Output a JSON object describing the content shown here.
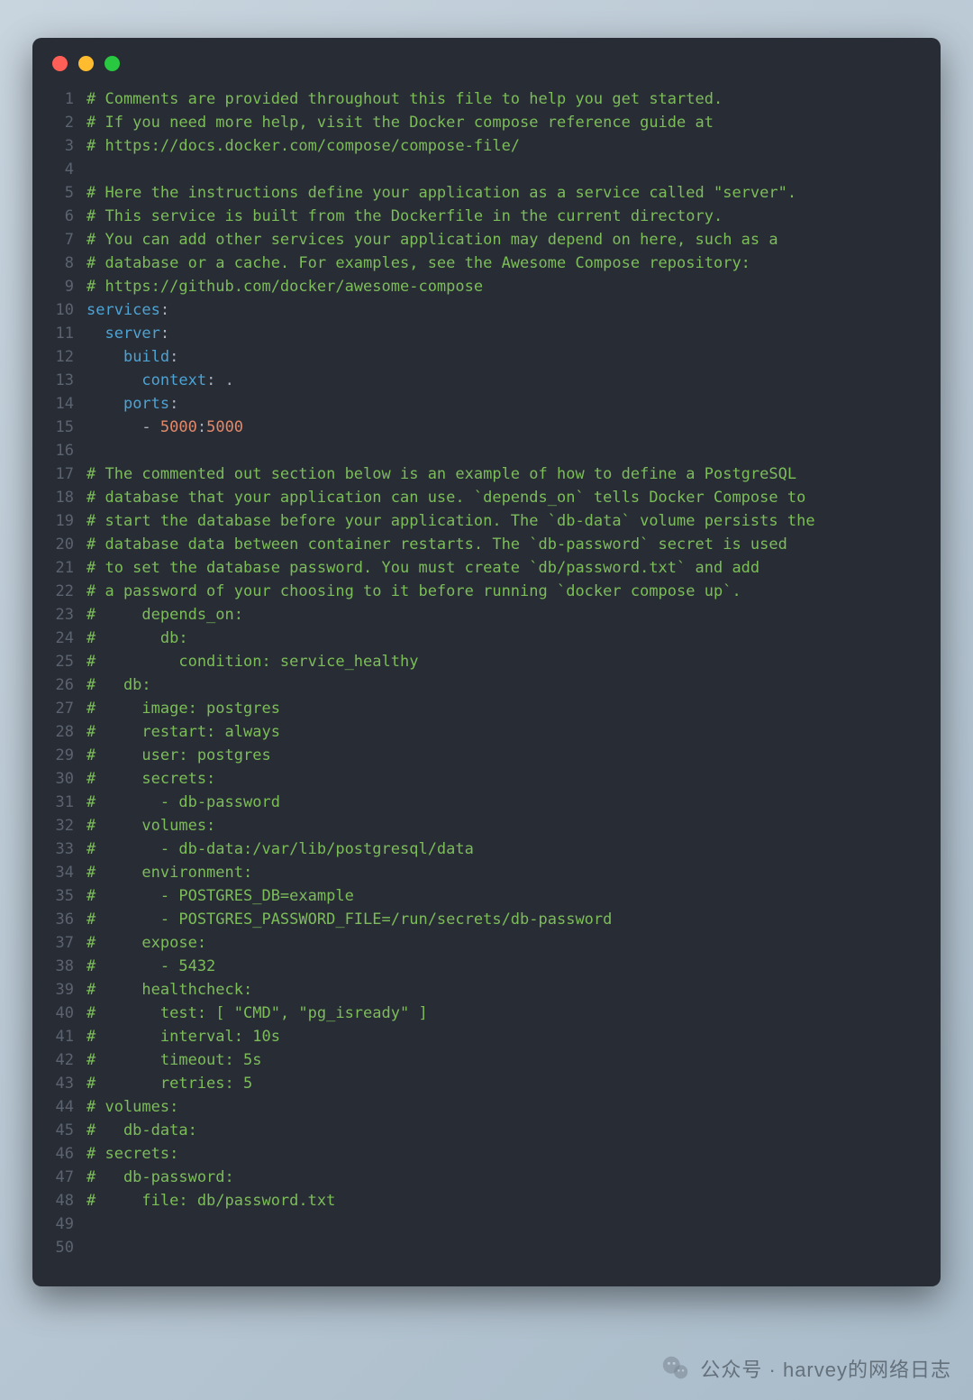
{
  "watermark": "公众号 · harvey的网络日志",
  "colors": {
    "bg": "#282c34",
    "comment": "#7cbd5a",
    "key": "#4da3d4",
    "num": "#e3896a",
    "default": "#abb2bf",
    "gutter": "#5c6370"
  },
  "lines": [
    {
      "n": 1,
      "tokens": [
        {
          "t": "# Comments are provided throughout this file to help you get started.",
          "cls": "c-comment"
        }
      ]
    },
    {
      "n": 2,
      "tokens": [
        {
          "t": "# If you need more help, visit the Docker compose reference guide at",
          "cls": "c-comment"
        }
      ]
    },
    {
      "n": 3,
      "tokens": [
        {
          "t": "# https://docs.docker.com/compose/compose-file/",
          "cls": "c-comment"
        }
      ]
    },
    {
      "n": 4,
      "tokens": [
        {
          "t": "",
          "cls": "c-plain"
        }
      ]
    },
    {
      "n": 5,
      "tokens": [
        {
          "t": "# Here the instructions define your application as a service called \"server\".",
          "cls": "c-comment"
        }
      ]
    },
    {
      "n": 6,
      "tokens": [
        {
          "t": "# This service is built from the Dockerfile in the current directory.",
          "cls": "c-comment"
        }
      ]
    },
    {
      "n": 7,
      "tokens": [
        {
          "t": "# You can add other services your application may depend on here, such as a",
          "cls": "c-comment"
        }
      ]
    },
    {
      "n": 8,
      "tokens": [
        {
          "t": "# database or a cache. For examples, see the Awesome Compose repository:",
          "cls": "c-comment"
        }
      ]
    },
    {
      "n": 9,
      "tokens": [
        {
          "t": "# https://github.com/docker/awesome-compose",
          "cls": "c-comment"
        }
      ]
    },
    {
      "n": 10,
      "tokens": [
        {
          "t": "services",
          "cls": "c-key"
        },
        {
          "t": ":",
          "cls": "c-punct"
        }
      ]
    },
    {
      "n": 11,
      "tokens": [
        {
          "t": "  ",
          "cls": "c-plain"
        },
        {
          "t": "server",
          "cls": "c-key"
        },
        {
          "t": ":",
          "cls": "c-punct"
        }
      ]
    },
    {
      "n": 12,
      "tokens": [
        {
          "t": "    ",
          "cls": "c-plain"
        },
        {
          "t": "build",
          "cls": "c-key"
        },
        {
          "t": ":",
          "cls": "c-punct"
        }
      ]
    },
    {
      "n": 13,
      "tokens": [
        {
          "t": "      ",
          "cls": "c-plain"
        },
        {
          "t": "context",
          "cls": "c-key"
        },
        {
          "t": ":",
          "cls": "c-punct"
        },
        {
          "t": " .",
          "cls": "c-plain"
        }
      ]
    },
    {
      "n": 14,
      "tokens": [
        {
          "t": "    ",
          "cls": "c-plain"
        },
        {
          "t": "ports",
          "cls": "c-key"
        },
        {
          "t": ":",
          "cls": "c-punct"
        }
      ]
    },
    {
      "n": 15,
      "tokens": [
        {
          "t": "      - ",
          "cls": "c-plain"
        },
        {
          "t": "5000",
          "cls": "c-num"
        },
        {
          "t": ":",
          "cls": "c-punct"
        },
        {
          "t": "5000",
          "cls": "c-num"
        }
      ]
    },
    {
      "n": 16,
      "tokens": [
        {
          "t": "",
          "cls": "c-plain"
        }
      ]
    },
    {
      "n": 17,
      "tokens": [
        {
          "t": "# The commented out section below is an example of how to define a PostgreSQL",
          "cls": "c-comment"
        }
      ]
    },
    {
      "n": 18,
      "tokens": [
        {
          "t": "# database that your application can use. `depends_on` tells Docker Compose to",
          "cls": "c-comment"
        }
      ]
    },
    {
      "n": 19,
      "tokens": [
        {
          "t": "# start the database before your application. The `db-data` volume persists the",
          "cls": "c-comment"
        }
      ]
    },
    {
      "n": 20,
      "tokens": [
        {
          "t": "# database data between container restarts. The `db-password` secret is used",
          "cls": "c-comment"
        }
      ]
    },
    {
      "n": 21,
      "tokens": [
        {
          "t": "# to set the database password. You must create `db/password.txt` and add",
          "cls": "c-comment"
        }
      ]
    },
    {
      "n": 22,
      "tokens": [
        {
          "t": "# a password of your choosing to it before running `docker compose up`.",
          "cls": "c-comment"
        }
      ]
    },
    {
      "n": 23,
      "tokens": [
        {
          "t": "#     depends_on:",
          "cls": "c-comment"
        }
      ]
    },
    {
      "n": 24,
      "tokens": [
        {
          "t": "#       db:",
          "cls": "c-comment"
        }
      ]
    },
    {
      "n": 25,
      "tokens": [
        {
          "t": "#         condition: service_healthy",
          "cls": "c-comment"
        }
      ]
    },
    {
      "n": 26,
      "tokens": [
        {
          "t": "#   db:",
          "cls": "c-comment"
        }
      ]
    },
    {
      "n": 27,
      "tokens": [
        {
          "t": "#     image: postgres",
          "cls": "c-comment"
        }
      ]
    },
    {
      "n": 28,
      "tokens": [
        {
          "t": "#     restart: always",
          "cls": "c-comment"
        }
      ]
    },
    {
      "n": 29,
      "tokens": [
        {
          "t": "#     user: postgres",
          "cls": "c-comment"
        }
      ]
    },
    {
      "n": 30,
      "tokens": [
        {
          "t": "#     secrets:",
          "cls": "c-comment"
        }
      ]
    },
    {
      "n": 31,
      "tokens": [
        {
          "t": "#       - db-password",
          "cls": "c-comment"
        }
      ]
    },
    {
      "n": 32,
      "tokens": [
        {
          "t": "#     volumes:",
          "cls": "c-comment"
        }
      ]
    },
    {
      "n": 33,
      "tokens": [
        {
          "t": "#       - db-data:/var/lib/postgresql/data",
          "cls": "c-comment"
        }
      ]
    },
    {
      "n": 34,
      "tokens": [
        {
          "t": "#     environment:",
          "cls": "c-comment"
        }
      ]
    },
    {
      "n": 35,
      "tokens": [
        {
          "t": "#       - POSTGRES_DB=example",
          "cls": "c-comment"
        }
      ]
    },
    {
      "n": 36,
      "tokens": [
        {
          "t": "#       - POSTGRES_PASSWORD_FILE=/run/secrets/db-password",
          "cls": "c-comment"
        }
      ]
    },
    {
      "n": 37,
      "tokens": [
        {
          "t": "#     expose:",
          "cls": "c-comment"
        }
      ]
    },
    {
      "n": 38,
      "tokens": [
        {
          "t": "#       - 5432",
          "cls": "c-comment"
        }
      ]
    },
    {
      "n": 39,
      "tokens": [
        {
          "t": "#     healthcheck:",
          "cls": "c-comment"
        }
      ]
    },
    {
      "n": 40,
      "tokens": [
        {
          "t": "#       test: [ \"CMD\", \"pg_isready\" ]",
          "cls": "c-comment"
        }
      ]
    },
    {
      "n": 41,
      "tokens": [
        {
          "t": "#       interval: 10s",
          "cls": "c-comment"
        }
      ]
    },
    {
      "n": 42,
      "tokens": [
        {
          "t": "#       timeout: 5s",
          "cls": "c-comment"
        }
      ]
    },
    {
      "n": 43,
      "tokens": [
        {
          "t": "#       retries: 5",
          "cls": "c-comment"
        }
      ]
    },
    {
      "n": 44,
      "tokens": [
        {
          "t": "# volumes:",
          "cls": "c-comment"
        }
      ]
    },
    {
      "n": 45,
      "tokens": [
        {
          "t": "#   db-data:",
          "cls": "c-comment"
        }
      ]
    },
    {
      "n": 46,
      "tokens": [
        {
          "t": "# secrets:",
          "cls": "c-comment"
        }
      ]
    },
    {
      "n": 47,
      "tokens": [
        {
          "t": "#   db-password:",
          "cls": "c-comment"
        }
      ]
    },
    {
      "n": 48,
      "tokens": [
        {
          "t": "#     file: db/password.txt",
          "cls": "c-comment"
        }
      ]
    },
    {
      "n": 49,
      "tokens": [
        {
          "t": "",
          "cls": "c-plain"
        }
      ]
    },
    {
      "n": 50,
      "tokens": [
        {
          "t": "",
          "cls": "c-plain"
        }
      ]
    }
  ]
}
